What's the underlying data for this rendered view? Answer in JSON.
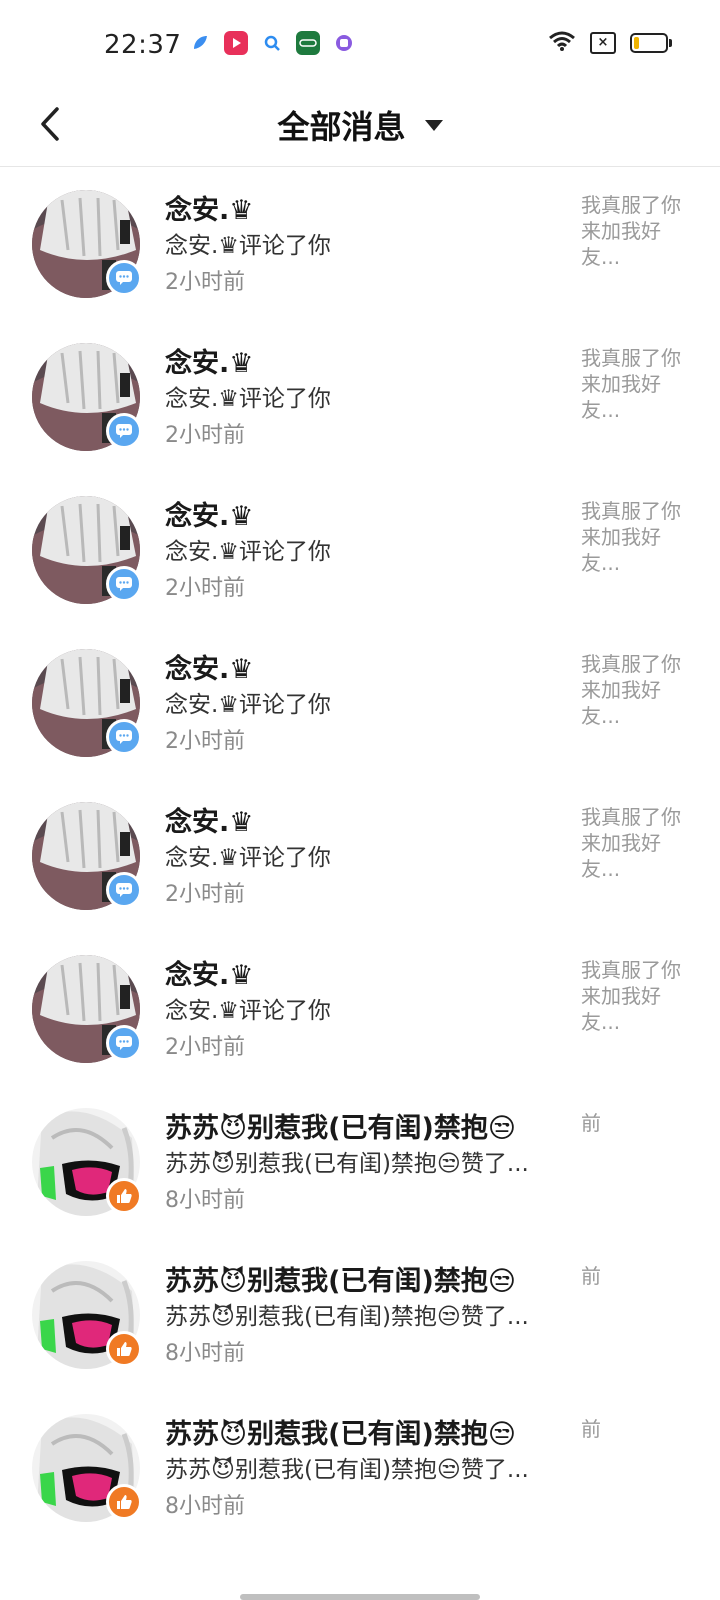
{
  "status_bar": {
    "time": "22:37",
    "apps": [
      {
        "icon": "feather-app-icon",
        "color": "#3b8ef0"
      },
      {
        "icon": "video-play-app-icon",
        "color": "#e8305a"
      },
      {
        "icon": "search-app-icon",
        "color": "#2d8cf0"
      },
      {
        "icon": "game-app-icon",
        "color": "#1e7a3e"
      },
      {
        "icon": "circle-app-icon",
        "color": "#8a5be0"
      }
    ],
    "icons": [
      "wifi-icon",
      "no-sim-icon",
      "battery-icon"
    ],
    "battery_level": 0.15,
    "battery_color": "#f0b400"
  },
  "header": {
    "back_icon": "back-arrow-icon",
    "title": "全部消息",
    "dropdown_icon": "caret-down-icon"
  },
  "messages": [
    {
      "name": "念安.♛",
      "text": "念安.♛评论了你",
      "time": "2小时前",
      "preview": "我真服了你来加我好友...",
      "type": "comment"
    },
    {
      "name": "念安.♛",
      "text": "念安.♛评论了你",
      "time": "2小时前",
      "preview": "我真服了你来加我好友...",
      "type": "comment"
    },
    {
      "name": "念安.♛",
      "text": "念安.♛评论了你",
      "time": "2小时前",
      "preview": "我真服了你来加我好友...",
      "type": "comment"
    },
    {
      "name": "念安.♛",
      "text": "念安.♛评论了你",
      "time": "2小时前",
      "preview": "我真服了你来加我好友...",
      "type": "comment"
    },
    {
      "name": "念安.♛",
      "text": "念安.♛评论了你",
      "time": "2小时前",
      "preview": "我真服了你来加我好友...",
      "type": "comment"
    },
    {
      "name": "念安.♛",
      "text": "念安.♛评论了你",
      "time": "2小时前",
      "preview": "我真服了你来加我好友...",
      "type": "comment"
    },
    {
      "name": "苏苏😈别惹我(已有闺)禁抱😒",
      "text": "苏苏😈别惹我(已有闺)禁抱😒赞了...",
      "time": "8小时前",
      "preview": "前",
      "type": "like"
    },
    {
      "name": "苏苏😈别惹我(已有闺)禁抱😒",
      "text": "苏苏😈别惹我(已有闺)禁抱😒赞了...",
      "time": "8小时前",
      "preview": "前",
      "type": "like"
    },
    {
      "name": "苏苏😈别惹我(已有闺)禁抱😒",
      "text": "苏苏😈别惹我(已有闺)禁抱😒赞了...",
      "time": "8小时前",
      "preview": "前",
      "type": "like"
    }
  ],
  "colors": {
    "comment_badge": "#5aa7f0",
    "like_badge": "#f07a24"
  }
}
